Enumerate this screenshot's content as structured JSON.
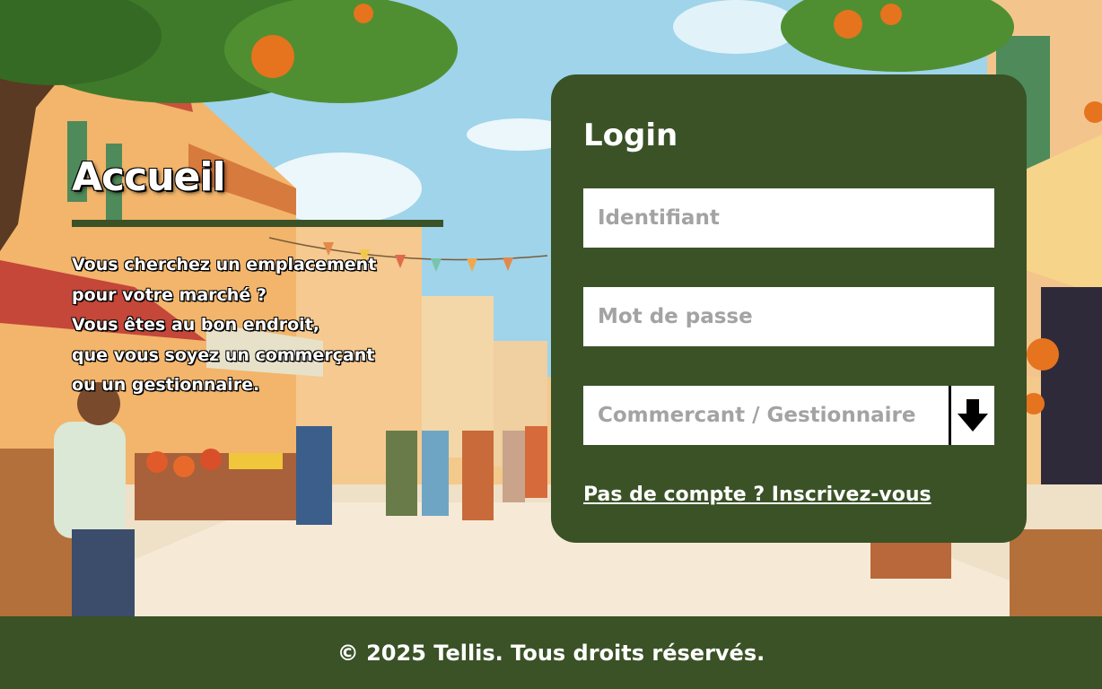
{
  "hero": {
    "title": "Accueil",
    "text": "Vous cherchez un emplacement\npour votre marché ?\nVous êtes au bon endroit,\nque vous soyez un commerçant\n ou un gestionnaire."
  },
  "login": {
    "title": "Login",
    "username_placeholder": "Identifiant",
    "password_placeholder": "Mot de passe",
    "role_select": {
      "selected": "Commercant / Gestionnaire",
      "arrow_icon": "arrow-down-icon"
    },
    "signup_link": "Pas de compte ? Inscrivez-vous"
  },
  "footer": {
    "text": "© 2025 Tellis. Tous droits réservés."
  },
  "colors": {
    "primary_green": "#3a5226",
    "white": "#ffffff",
    "placeholder_gray": "#a3a3a3"
  }
}
